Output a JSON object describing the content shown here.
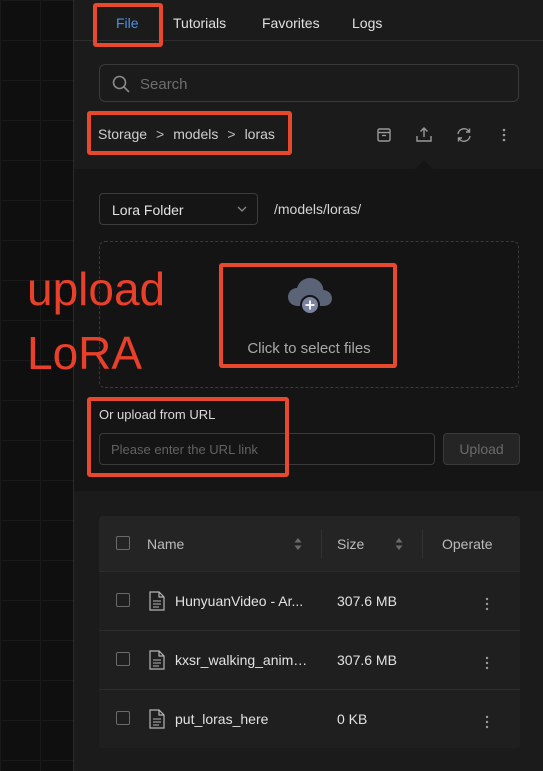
{
  "tabs": [
    {
      "label": "File",
      "active": true
    },
    {
      "label": "Tutorials"
    },
    {
      "label": "Favorites"
    },
    {
      "label": "Logs"
    }
  ],
  "search": {
    "placeholder": "Search"
  },
  "breadcrumb": [
    "Storage",
    "models",
    "loras"
  ],
  "breadcrumb_separator": ">",
  "toolbar_icons": [
    "archive-icon",
    "upload-icon",
    "refresh-icon",
    "more-vertical-icon"
  ],
  "upload": {
    "folder_select_value": "Lora Folder",
    "folder_path": "/models/loras/",
    "dropzone_text": "Click to select files",
    "url_label": "Or upload from URL",
    "url_placeholder": "Please enter the URL link",
    "upload_button": "Upload"
  },
  "table": {
    "columns": {
      "name": "Name",
      "size": "Size",
      "operate": "Operate"
    },
    "rows": [
      {
        "name": "HunyuanVideo - Ar...",
        "size": "307.6 MB"
      },
      {
        "name": "kxsr_walking_anim_...",
        "size": "307.6 MB"
      },
      {
        "name": "put_loras_here",
        "size": "0 KB"
      }
    ]
  },
  "annotation": {
    "line1": "upload",
    "line2": "LoRA",
    "color": "#e8482c"
  },
  "colors": {
    "accent": "#4a90e2",
    "panel": "#1b1b1b",
    "annotation": "#e8482c"
  }
}
